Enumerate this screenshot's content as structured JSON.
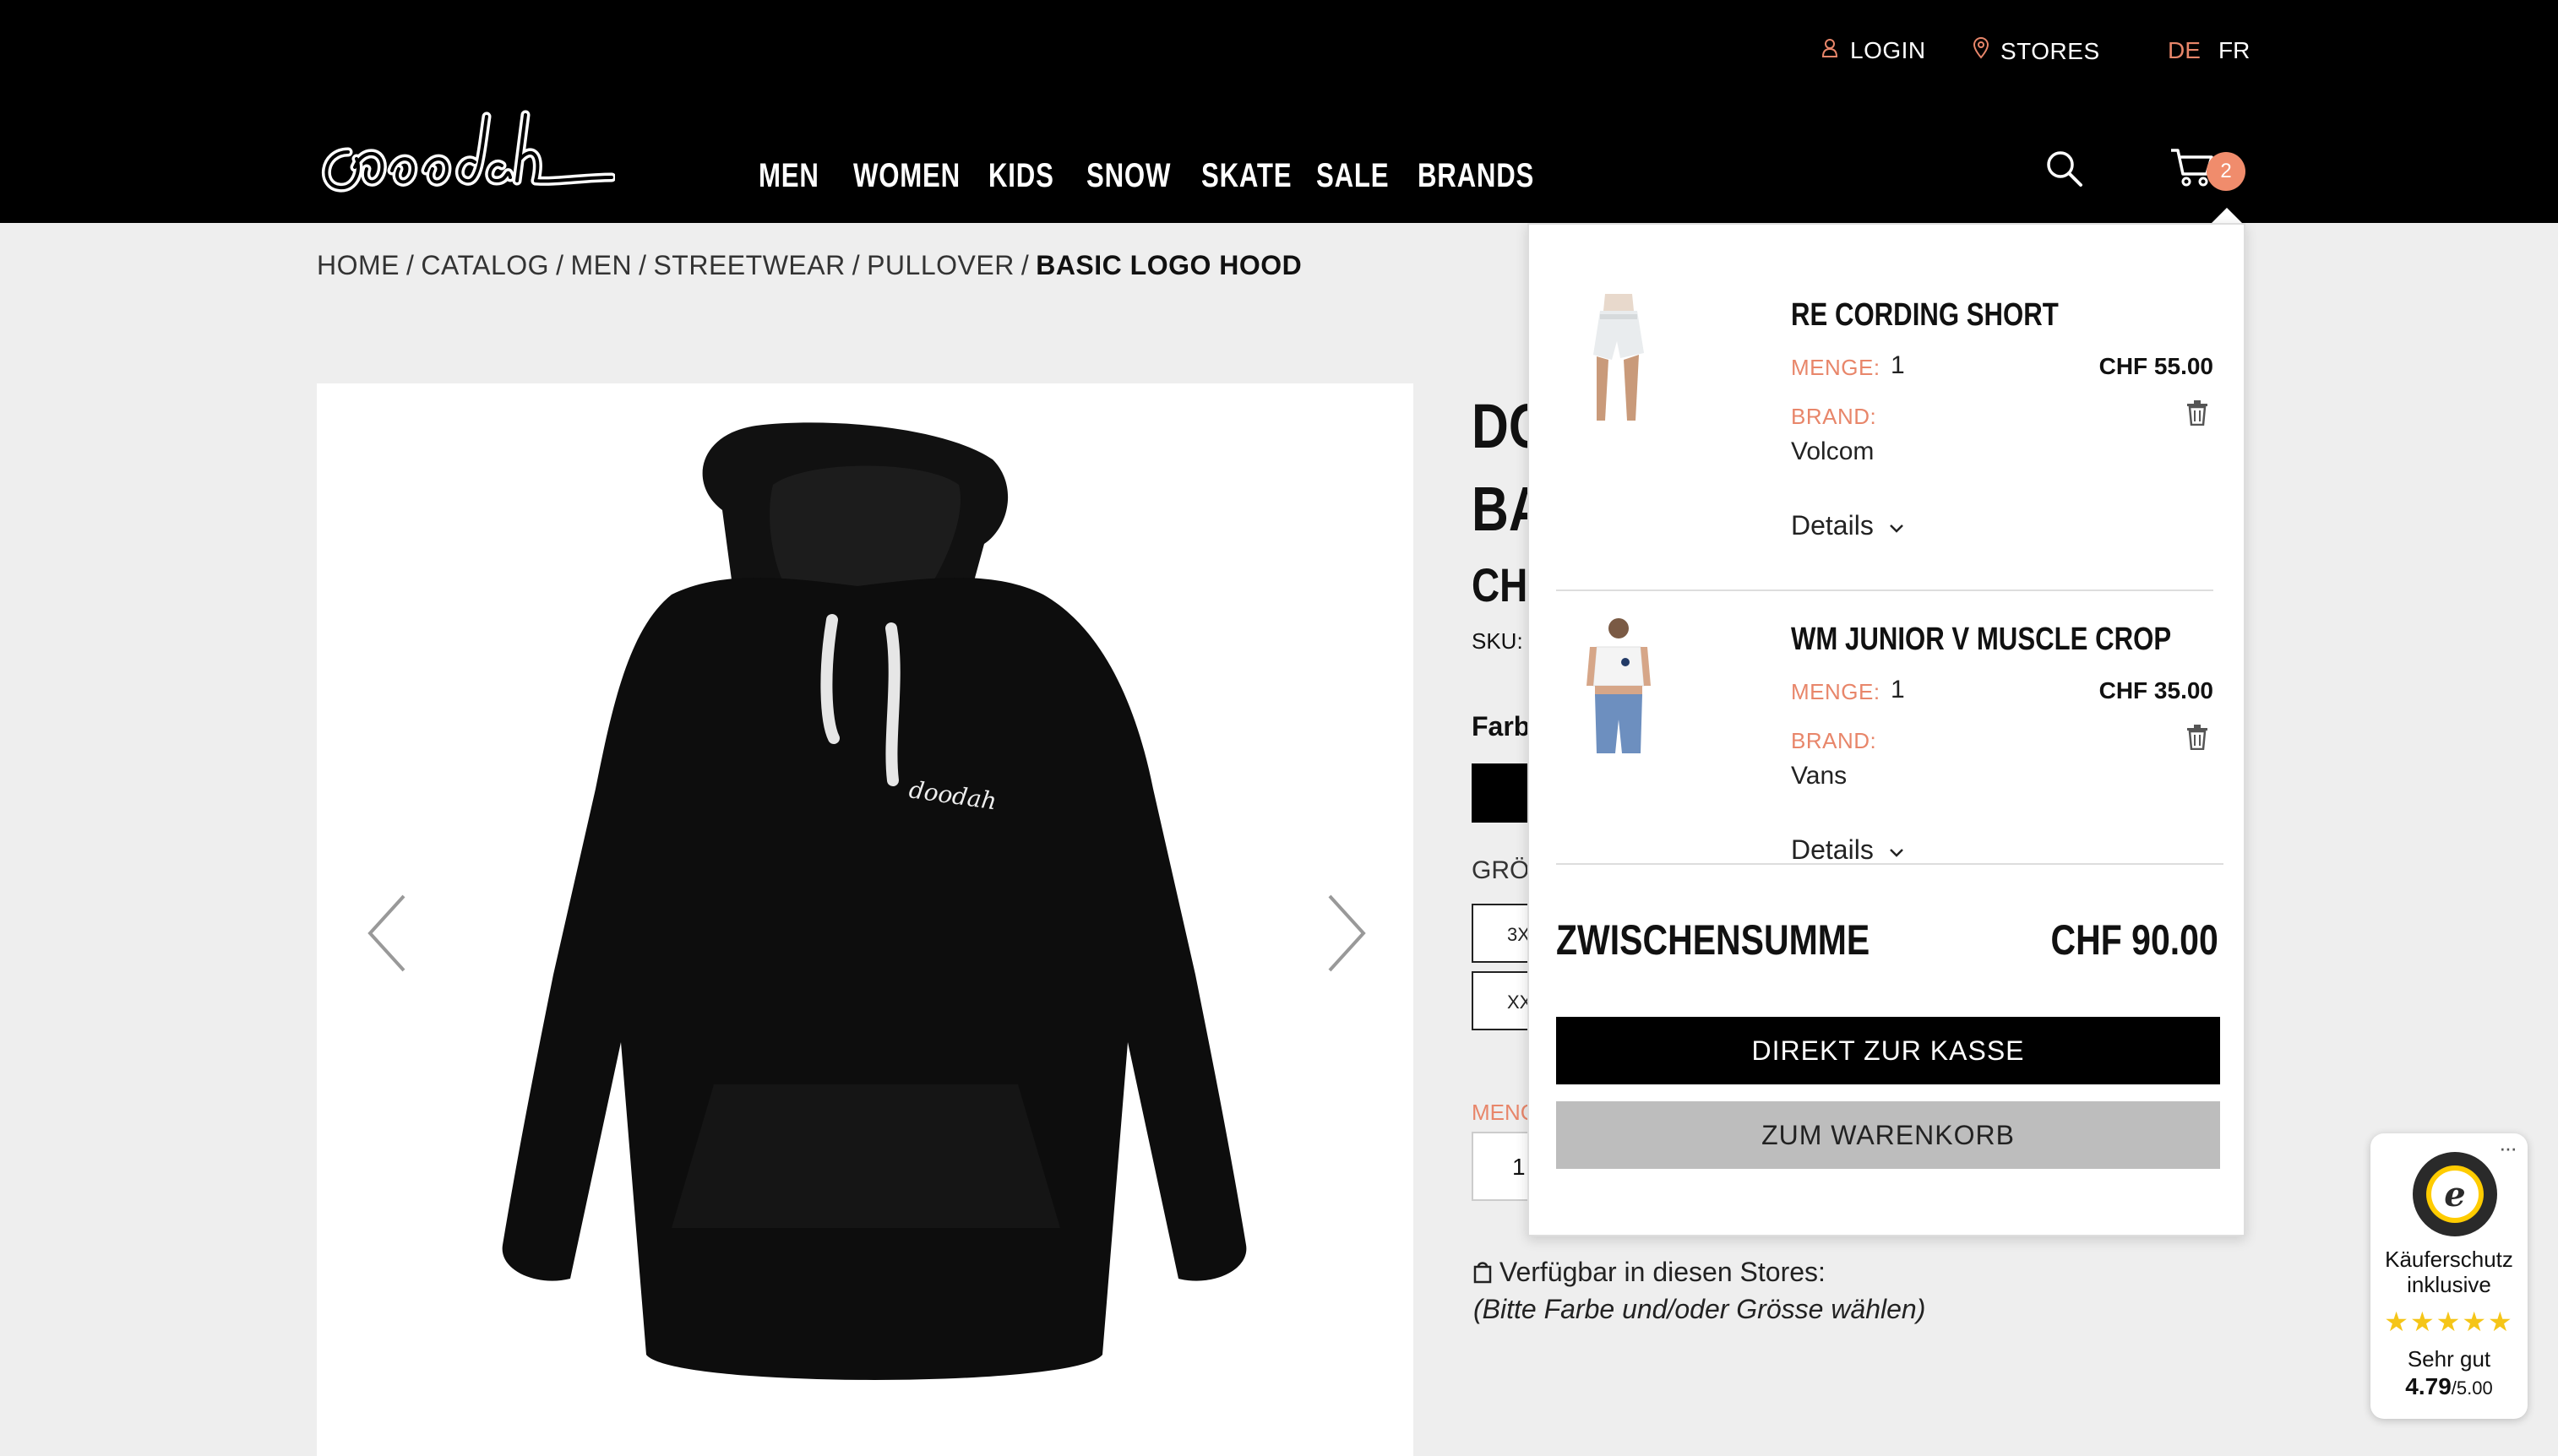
{
  "header": {
    "login_label": "LOGIN",
    "stores_label": "STORES",
    "lang_de": "DE",
    "lang_fr": "FR",
    "logo_icon": "doodah-logo",
    "nav": [
      "MEN",
      "WOMEN",
      "KIDS",
      "SNOW",
      "SKATE",
      "SALE",
      "BRANDS"
    ],
    "cart_count": "2",
    "accent_color": "#f08c6c"
  },
  "breadcrumb": [
    "HOME",
    "CATALOG",
    "MEN",
    "STREETWEAR",
    "PULLOVER",
    "BASIC LOGO HOOD"
  ],
  "breadcrumb_sep": "/",
  "product": {
    "title_line1": "DO",
    "title_line2": "BA",
    "price_partial": "CHF",
    "sku_label": "SKU:",
    "color_label": "Farb",
    "size_label": "GRÖ",
    "sizes_partial": [
      "3X",
      "XX"
    ],
    "qty_label": "MENG",
    "qty_value": "1",
    "stores_text": "Verfügbar in diesen Stores:",
    "stores_note": "(Bitte Farbe und/oder Grösse wählen)"
  },
  "minicart": {
    "items": [
      {
        "name": "RE CORDING SHORT",
        "qty_label": "MENGE:",
        "qty": "1",
        "price": "CHF 55.00",
        "brand_label": "BRAND:",
        "brand": "Volcom",
        "details_label": "Details"
      },
      {
        "name": "WM JUNIOR V MUSCLE CROP",
        "qty_label": "MENGE:",
        "qty": "1",
        "price": "CHF 35.00",
        "brand_label": "BRAND:",
        "brand": "Vans",
        "details_label": "Details"
      }
    ],
    "subtotal_label": "ZWISCHENSUMME",
    "subtotal_value": "CHF 90.00",
    "checkout_label": "DIREKT ZUR KASSE",
    "cart_label": "ZUM WARENKORB"
  },
  "trusted": {
    "line1": "Käuferschutz",
    "line2": "inklusive",
    "stars": "★★★★★",
    "rating_label": "Sehr gut",
    "score": "4.79",
    "score_max": "/5.00"
  }
}
